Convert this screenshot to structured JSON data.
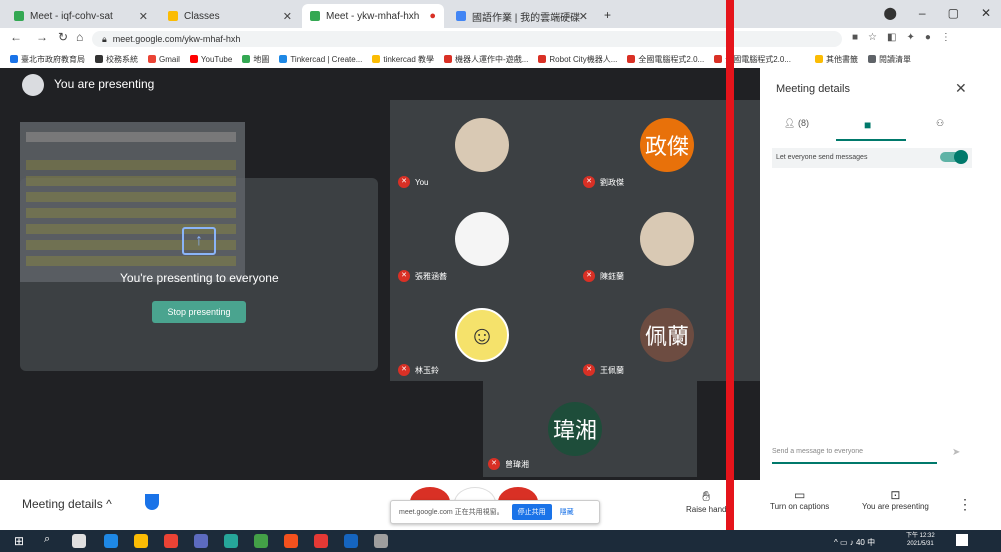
{
  "browser": {
    "tabs": [
      {
        "label": "Meet - iqf-cohv-sat",
        "color": "#34a853"
      },
      {
        "label": "Classes",
        "color": "#fbbc04"
      },
      {
        "label": "Meet - ykw-mhaf-hxh",
        "color": "#34a853"
      },
      {
        "label": "國語作業 | 我的雲端硬碟",
        "color": "#4285f4"
      }
    ],
    "url": "meet.google.com/ykw-mhaf-hxh",
    "bookmarks": [
      "臺北市政府教育局",
      "校務系統",
      "Gmail",
      "YouTube",
      "地圖",
      "Tinkercad | Create...",
      "tinkercad 教學",
      "機器人運作中-遊戲...",
      "Robot City機器人...",
      "全國電腦程式2.0...",
      "全國電腦程式2.0...",
      "其他書籤",
      "閱讀清單"
    ]
  },
  "meet": {
    "presenting_label": "You are presenting",
    "presenting_to_everyone": "You're presenting to everyone",
    "stop_presenting": "Stop presenting",
    "participants": [
      {
        "name": "You",
        "initials": "",
        "color": "#d9c9b4"
      },
      {
        "name": "劉政傑",
        "initials": "政傑",
        "color": "#e8710a"
      },
      {
        "name": "張雅涵蕎",
        "initials": "",
        "color": "#f5f5f5"
      },
      {
        "name": "陳鈺蘭",
        "initials": "",
        "color": "#d9c9b4"
      },
      {
        "name": "林玉鈴",
        "initials": "",
        "color": "#f5e26b"
      },
      {
        "name": "王佩蘭",
        "initials": "佩蘭",
        "color": "#6d4c41"
      },
      {
        "name": "曾瑋湘",
        "initials": "瑋湘",
        "color": "#1e4d3a"
      }
    ],
    "bottom": {
      "meeting_details": "Meeting details",
      "raise_hand": "Raise hand",
      "turn_on_captions": "Turn on captions",
      "you_are_presenting": "You are presenting"
    },
    "share_bar": {
      "text": "meet.google.com 正在共用視窗。",
      "stop": "停止共用",
      "hide": "隱藏"
    }
  },
  "panel": {
    "title": "Meeting details",
    "people_count": "(8)",
    "setting": "Let everyone send messages",
    "message_placeholder": "Send a message to everyone"
  },
  "taskbar": {
    "time": "下午 12:32",
    "date": "2021/5/31",
    "lang": "中"
  }
}
